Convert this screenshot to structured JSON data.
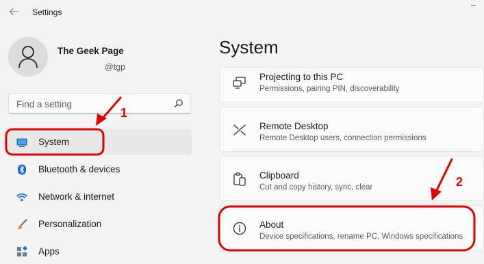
{
  "window": {
    "title": "Settings",
    "back_icon": "back-arrow-icon",
    "minimize_glyph": "–"
  },
  "user": {
    "name": "The Geek Page",
    "handle": "@tgp"
  },
  "search": {
    "placeholder": "Find a setting",
    "icon": "search-icon"
  },
  "sidebar": {
    "items": [
      {
        "label": "System",
        "icon": "system-display-icon",
        "selected": true
      },
      {
        "label": "Bluetooth & devices",
        "icon": "bluetooth-icon"
      },
      {
        "label": "Network & internet",
        "icon": "wifi-icon"
      },
      {
        "label": "Personalization",
        "icon": "brush-icon"
      },
      {
        "label": "Apps",
        "icon": "apps-icon"
      }
    ]
  },
  "main": {
    "title": "System",
    "cards": [
      {
        "title": "Projecting to this PC",
        "subtitle": "Permissions, pairing PIN, discoverability",
        "icon": "projecting-icon"
      },
      {
        "title": "Remote Desktop",
        "subtitle": "Remote Desktop users, connection permissions",
        "icon": "remote-desktop-icon"
      },
      {
        "title": "Clipboard",
        "subtitle": "Cut and copy history, sync, clear",
        "icon": "clipboard-icon"
      },
      {
        "title": "About",
        "subtitle": "Device specifications, rename PC, Windows specifications",
        "icon": "info-icon"
      }
    ]
  },
  "annotations": {
    "step1": "1",
    "step2": "2",
    "color": "#e00000"
  },
  "colors": {
    "accent": "#0067c0",
    "selected_bg": "#e8e8e8",
    "window_bg": "#f3f3f3",
    "card_bg": "#fbfbfb"
  }
}
